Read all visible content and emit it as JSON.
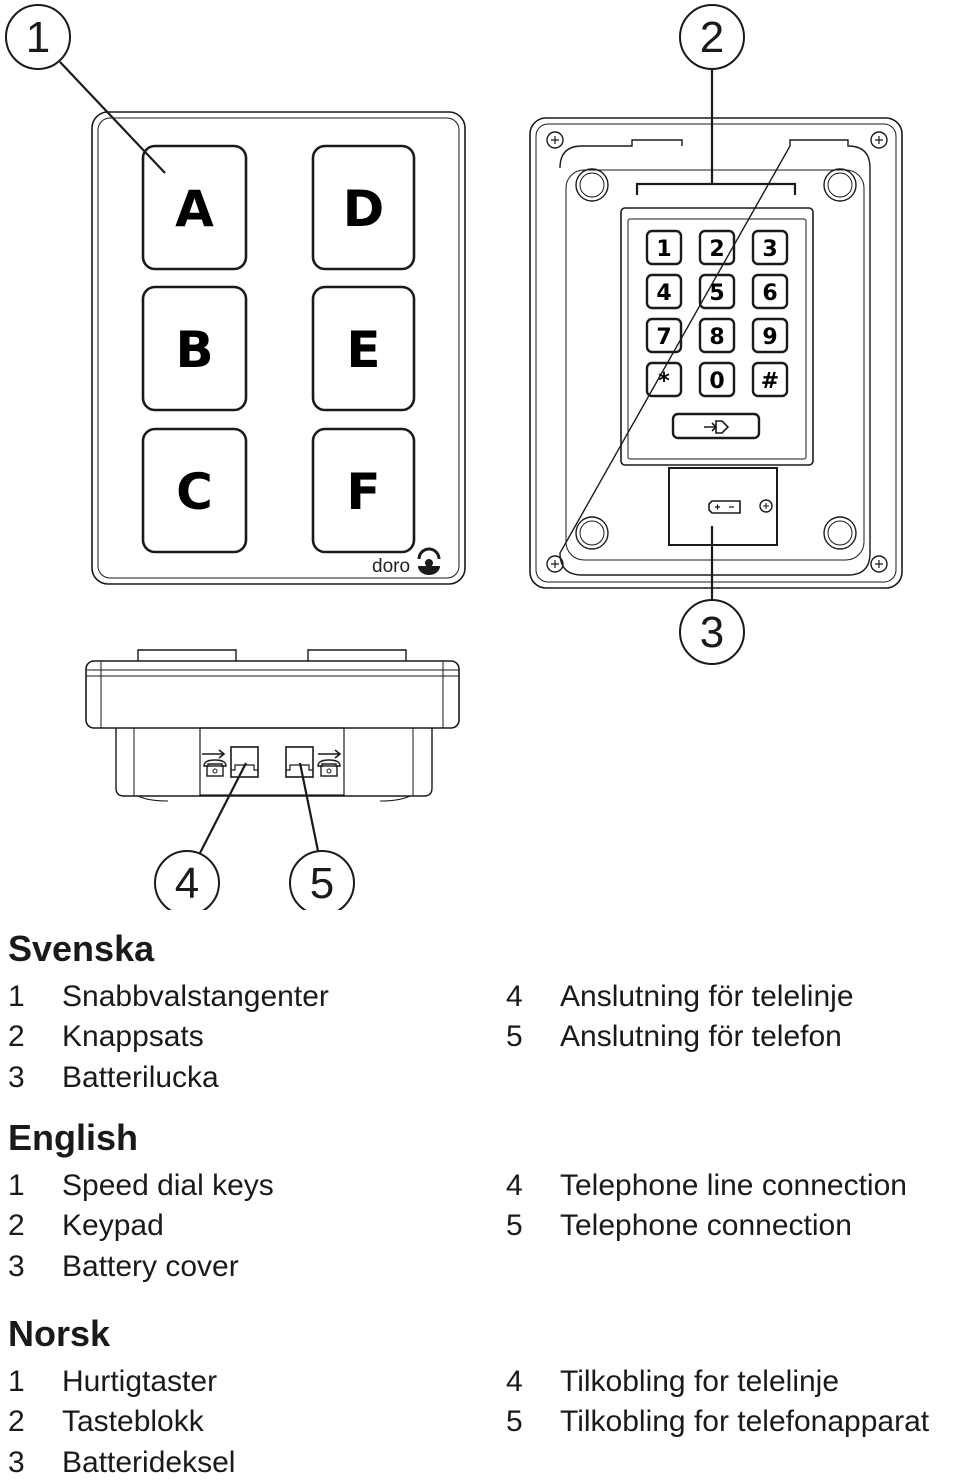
{
  "figure": {
    "callouts": [
      "1",
      "2",
      "3",
      "4",
      "5"
    ],
    "speed_dial_keys": [
      "A",
      "D",
      "B",
      "E",
      "C",
      "F"
    ],
    "keypad_keys": [
      "1",
      "2",
      "3",
      "4",
      "5",
      "6",
      "7",
      "8",
      "9",
      "*",
      "0",
      "#"
    ],
    "keypad_enter_icon": "enter-arrow-icon",
    "battery_icon_label": "+ -",
    "brand": "doro",
    "ports": [
      {
        "icon": "telephone-line-in-icon"
      },
      {
        "icon": "telephone-out-icon"
      }
    ]
  },
  "legend": [
    {
      "language": "Svenska",
      "items": [
        {
          "num": "1",
          "text": "Snabbvalstangenter"
        },
        {
          "num": "2",
          "text": "Knappsats"
        },
        {
          "num": "3",
          "text": "Batterilucka"
        },
        {
          "num": "4",
          "text": "Anslutning för telelinje"
        },
        {
          "num": "5",
          "text": "Anslutning för telefon"
        }
      ]
    },
    {
      "language": "English",
      "items": [
        {
          "num": "1",
          "text": "Speed dial keys"
        },
        {
          "num": "2",
          "text": "Keypad"
        },
        {
          "num": "3",
          "text": "Battery cover"
        },
        {
          "num": "4",
          "text": "Telephone line connection"
        },
        {
          "num": "5",
          "text": "Telephone connection"
        }
      ]
    },
    {
      "language": "Norsk",
      "items": [
        {
          "num": "1",
          "text": "Hurtigtaster"
        },
        {
          "num": "2",
          "text": "Tasteblokk"
        },
        {
          "num": "3",
          "text": "Batterideksel"
        },
        {
          "num": "4",
          "text": "Tilkobling for telelinje"
        },
        {
          "num": "5",
          "text": "Tilkobling for telefonapparat"
        }
      ]
    }
  ]
}
